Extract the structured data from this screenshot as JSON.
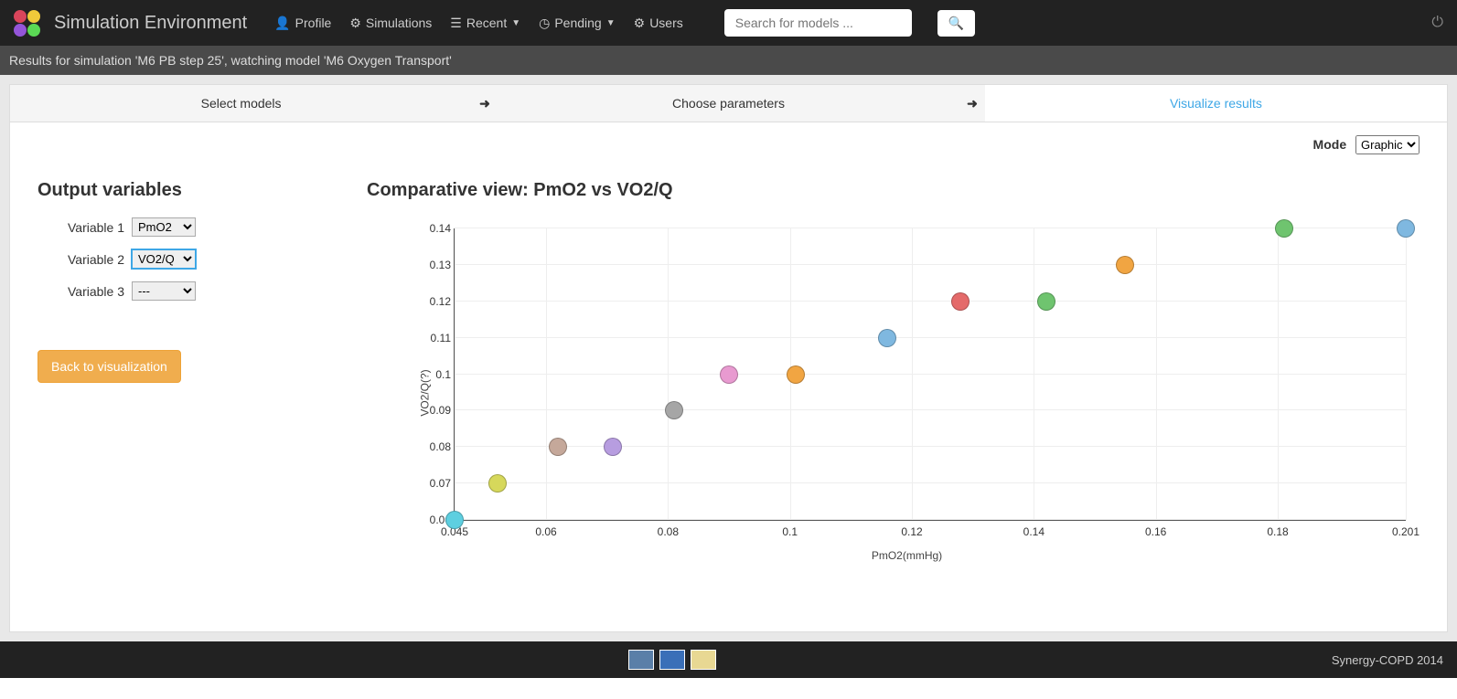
{
  "navbar": {
    "brand": "Simulation Environment",
    "links": {
      "profile": "Profile",
      "simulations": "Simulations",
      "recent": "Recent",
      "pending": "Pending",
      "users": "Users"
    },
    "search_placeholder": "Search for models ..."
  },
  "subheader": "Results for simulation 'M6 PB step 25', watching model 'M6 Oxygen Transport'",
  "wizard": {
    "step1": "Select models",
    "step2": "Choose parameters",
    "step3": "Visualize results"
  },
  "sidebar": {
    "title": "Output variables",
    "var1_label": "Variable 1",
    "var1_value": "PmO2",
    "var2_label": "Variable 2",
    "var2_value": "VO2/Q",
    "var3_label": "Variable 3",
    "var3_value": "---",
    "back_btn": "Back to visualization"
  },
  "mode": {
    "label": "Mode",
    "value": "Graphic"
  },
  "chart_title": "Comparative view: PmO2 vs VO2/Q",
  "chart_data": {
    "type": "scatter",
    "title": "Comparative view: PmO2 vs VO2/Q",
    "xlabel": "PmO2(mmHg)",
    "ylabel": "VO2/Q(?)",
    "xlim": [
      0.045,
      0.201
    ],
    "ylim": [
      0.06,
      0.14
    ],
    "xticks": [
      0.045,
      0.06,
      0.08,
      0.1,
      0.12,
      0.14,
      0.16,
      0.18,
      0.201
    ],
    "yticks": [
      0.06,
      0.07,
      0.08,
      0.09,
      0.1,
      0.11,
      0.12,
      0.13,
      0.14
    ],
    "points": [
      {
        "x": 0.045,
        "y": 0.06,
        "color": "#5ecfe0"
      },
      {
        "x": 0.052,
        "y": 0.07,
        "color": "#d6d85b"
      },
      {
        "x": 0.062,
        "y": 0.08,
        "color": "#c5a89a"
      },
      {
        "x": 0.071,
        "y": 0.08,
        "color": "#b79de0"
      },
      {
        "x": 0.081,
        "y": 0.09,
        "color": "#a6a6a6"
      },
      {
        "x": 0.09,
        "y": 0.1,
        "color": "#e89ad0"
      },
      {
        "x": 0.101,
        "y": 0.1,
        "color": "#f1a542"
      },
      {
        "x": 0.116,
        "y": 0.11,
        "color": "#7fb8e0"
      },
      {
        "x": 0.128,
        "y": 0.12,
        "color": "#e46a6a"
      },
      {
        "x": 0.142,
        "y": 0.12,
        "color": "#6fc46f"
      },
      {
        "x": 0.155,
        "y": 0.13,
        "color": "#f1a542"
      },
      {
        "x": 0.181,
        "y": 0.14,
        "color": "#6fc46f"
      },
      {
        "x": 0.201,
        "y": 0.14,
        "color": "#7fb8e0"
      }
    ]
  },
  "footer": {
    "text": "Synergy-COPD 2014"
  }
}
